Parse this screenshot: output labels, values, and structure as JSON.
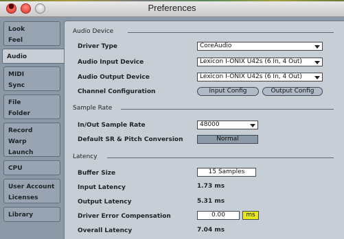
{
  "window": {
    "title": "Preferences"
  },
  "sidebar": {
    "tabs": [
      {
        "line1": "Look",
        "line2": "Feel"
      },
      {
        "line1": "Audio",
        "line2": ""
      },
      {
        "line1": "MIDI",
        "line2": "Sync"
      },
      {
        "line1": "File",
        "line2": "Folder"
      },
      {
        "line1": "Record",
        "line2": "Warp",
        "line3": "Launch"
      },
      {
        "line1": "CPU",
        "line2": ""
      },
      {
        "line1": "User Account",
        "line2": "Licenses"
      },
      {
        "line1": "Library",
        "line2": ""
      }
    ],
    "active_tab": "Audio"
  },
  "audio_device": {
    "heading": "Audio Device",
    "driver_type_label": "Driver Type",
    "driver_type_value": "CoreAudio",
    "input_device_label": "Audio Input Device",
    "input_device_value": "Lexicon I-ONIX U42s (6 In, 4 Out)",
    "output_device_label": "Audio Output Device",
    "output_device_value": "Lexicon I-ONIX U42s (6 In, 4 Out)",
    "channel_config_label": "Channel Configuration",
    "input_config_button": "Input Config",
    "output_config_button": "Output Config"
  },
  "sample_rate": {
    "heading": "Sample Rate",
    "in_out_label": "In/Out Sample Rate",
    "in_out_value": "48000",
    "default_sr_label": "Default SR & Pitch Conversion",
    "default_sr_value": "Normal"
  },
  "latency": {
    "heading": "Latency",
    "buffer_size_label": "Buffer Size",
    "buffer_size_value": "15 Samples",
    "input_latency_label": "Input Latency",
    "input_latency_value": "1.73 ms",
    "output_latency_label": "Output Latency",
    "output_latency_value": "5.31 ms",
    "driver_error_label": "Driver Error Compensation",
    "driver_error_value": "0.00",
    "driver_error_unit": "ms",
    "overall_latency_label": "Overall Latency",
    "overall_latency_value": "7.04 ms"
  },
  "colors": {
    "panel_bg": "#c8ced6",
    "sidebar_bg": "#8b98a6",
    "unit_highlight": "#e8e81a"
  }
}
